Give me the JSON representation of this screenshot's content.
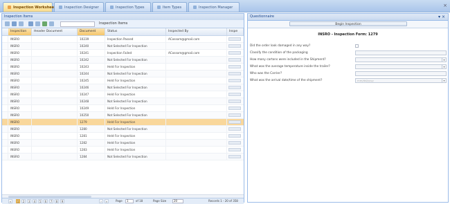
{
  "tabs": [
    {
      "label": "Inspection Worksheet",
      "active": true
    },
    {
      "label": "Inspection Designer",
      "active": false
    },
    {
      "label": "Inspection Types",
      "active": false
    },
    {
      "label": "Item Types",
      "active": false
    },
    {
      "label": "Inspection Manager",
      "active": false
    }
  ],
  "left_panel": {
    "title": "Inspection Items",
    "toolbar_label": "Inspection Items",
    "columns": [
      "Inspection",
      "Header Document",
      "Document",
      "Status",
      "Inspected By",
      "Inspe"
    ],
    "rows": [
      {
        "inspection": "INSRO",
        "header_doc": "",
        "document": "10239",
        "status": "Inspection Passed",
        "inspected_by": "ACossom@gmail.com"
      },
      {
        "inspection": "INSRO",
        "header_doc": "",
        "document": "10240",
        "status": "Not Selected For Inspection",
        "inspected_by": ""
      },
      {
        "inspection": "INSRO",
        "header_doc": "",
        "document": "10241",
        "status": "Inspection Failed",
        "inspected_by": "ACossom@gmail.com"
      },
      {
        "inspection": "INSRO",
        "header_doc": "",
        "document": "10242",
        "status": "Not Selected For Inspection",
        "inspected_by": ""
      },
      {
        "inspection": "INSRO",
        "header_doc": "",
        "document": "10243",
        "status": "Held For Inspection",
        "inspected_by": ""
      },
      {
        "inspection": "INSRO",
        "header_doc": "",
        "document": "10244",
        "status": "Not Selected For Inspection",
        "inspected_by": ""
      },
      {
        "inspection": "INSRO",
        "header_doc": "",
        "document": "10245",
        "status": "Held For Inspection",
        "inspected_by": ""
      },
      {
        "inspection": "INSRO",
        "header_doc": "",
        "document": "10246",
        "status": "Not Selected For Inspection",
        "inspected_by": ""
      },
      {
        "inspection": "INSRO",
        "header_doc": "",
        "document": "10247",
        "status": "Held For Inspection",
        "inspected_by": ""
      },
      {
        "inspection": "INSRO",
        "header_doc": "",
        "document": "10248",
        "status": "Not Selected For Inspection",
        "inspected_by": ""
      },
      {
        "inspection": "INSRO",
        "header_doc": "",
        "document": "10249",
        "status": "Held For Inspection",
        "inspected_by": ""
      },
      {
        "inspection": "INSRO",
        "header_doc": "",
        "document": "10250",
        "status": "Not Selected For Inspection",
        "inspected_by": ""
      },
      {
        "inspection": "INSRO",
        "header_doc": "",
        "document": "1279",
        "status": "Held For Inspection",
        "inspected_by": "",
        "selected": true
      },
      {
        "inspection": "INSRO",
        "header_doc": "",
        "document": "1280",
        "status": "Not Selected For Inspection",
        "inspected_by": ""
      },
      {
        "inspection": "INSRO",
        "header_doc": "",
        "document": "1281",
        "status": "Held For Inspection",
        "inspected_by": ""
      },
      {
        "inspection": "INSRO",
        "header_doc": "",
        "document": "1282",
        "status": "Held For Inspection",
        "inspected_by": ""
      },
      {
        "inspection": "INSRO",
        "header_doc": "",
        "document": "1283",
        "status": "Held For Inspection",
        "inspected_by": ""
      },
      {
        "inspection": "INSRO",
        "header_doc": "",
        "document": "1284",
        "status": "Not Selected For Inspection",
        "inspected_by": ""
      }
    ],
    "pager": {
      "pages": [
        "1",
        "2",
        "3",
        "4",
        "5",
        "6",
        "7",
        "8",
        "9"
      ],
      "current": "1",
      "page_label": "Page",
      "page_value": "1",
      "of_label": "of 18",
      "page_size_label": "Page Size",
      "page_size_value": "20",
      "records_label": "Records 1 - 20 of 358"
    }
  },
  "right_panel": {
    "title": "Questionnaire",
    "button_label": "Begin Inspection",
    "form_title": "INSRO - Inspection Form: 1279",
    "questions": [
      {
        "label": "Did the order look damaged in any way?",
        "type": "checkbox"
      },
      {
        "label": "Classify the condition of the packaging",
        "type": "text"
      },
      {
        "label": "How many cartons were included in the Shipment?",
        "type": "select"
      },
      {
        "label": "What was the average temperature inside the trailer?",
        "type": "select"
      },
      {
        "label": "Who was the Carrier?",
        "type": "text"
      },
      {
        "label": "What was the arrival date/time of the shipment?",
        "type": "select",
        "placeholder": "mm/dd/yyyy"
      }
    ]
  },
  "colors": {
    "accent": "#f5c56a",
    "header_blue": "#15428b",
    "selected_row": "#f9d79b"
  }
}
